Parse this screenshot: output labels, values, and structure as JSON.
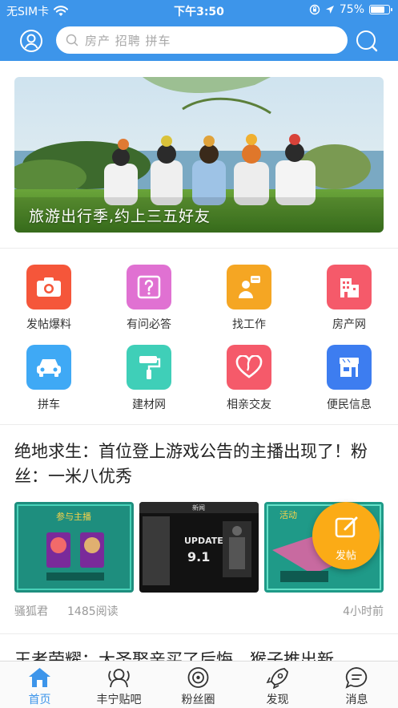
{
  "status_bar": {
    "carrier": "无SIM卡",
    "time": "下午3:50",
    "battery": "75%",
    "battery_level": 0.75
  },
  "search": {
    "placeholder": "房产 招聘 拼车"
  },
  "banner": {
    "caption": "旅游出行季,约上三五好友"
  },
  "grid": [
    {
      "label": "发帖爆料",
      "icon": "camera-icon",
      "color": "#f5563a"
    },
    {
      "label": "有问必答",
      "icon": "question-icon",
      "color": "#e071d2"
    },
    {
      "label": "找工作",
      "icon": "job-icon",
      "color": "#f5a623"
    },
    {
      "label": "房产网",
      "icon": "building-icon",
      "color": "#f55a6a"
    },
    {
      "label": "拼车",
      "icon": "car-icon",
      "color": "#3fa9f5"
    },
    {
      "label": "建材网",
      "icon": "paint-roller-icon",
      "color": "#3fcfb8"
    },
    {
      "label": "相亲交友",
      "icon": "heart-icon",
      "color": "#f55a6a"
    },
    {
      "label": "便民信息",
      "icon": "shop-icon",
      "color": "#3d7df0"
    }
  ],
  "article": {
    "title": "绝地求生：首位登上游戏公告的主播出现了！粉丝：一米八优秀",
    "author": "骚狐君",
    "reads": "1485阅读",
    "time": "4小时前",
    "thumb_texts": [
      "参与主播",
      "新闻",
      "UPDATE",
      "9.1",
      "活动"
    ]
  },
  "article2": {
    "title": "王者荣耀：大圣娶亲买了后悔，猴子推出新"
  },
  "fab": {
    "label": "发帖"
  },
  "tabs": [
    {
      "label": "首页",
      "icon": "home-icon",
      "active": true
    },
    {
      "label": "丰宁贴吧",
      "icon": "community-icon",
      "active": false
    },
    {
      "label": "粉丝圈",
      "icon": "fan-circle-icon",
      "active": false
    },
    {
      "label": "发现",
      "icon": "rocket-icon",
      "active": false
    },
    {
      "label": "消息",
      "icon": "message-icon",
      "active": false
    }
  ],
  "colors": {
    "accent": "#3d95ea",
    "fab": "#fbab16"
  }
}
